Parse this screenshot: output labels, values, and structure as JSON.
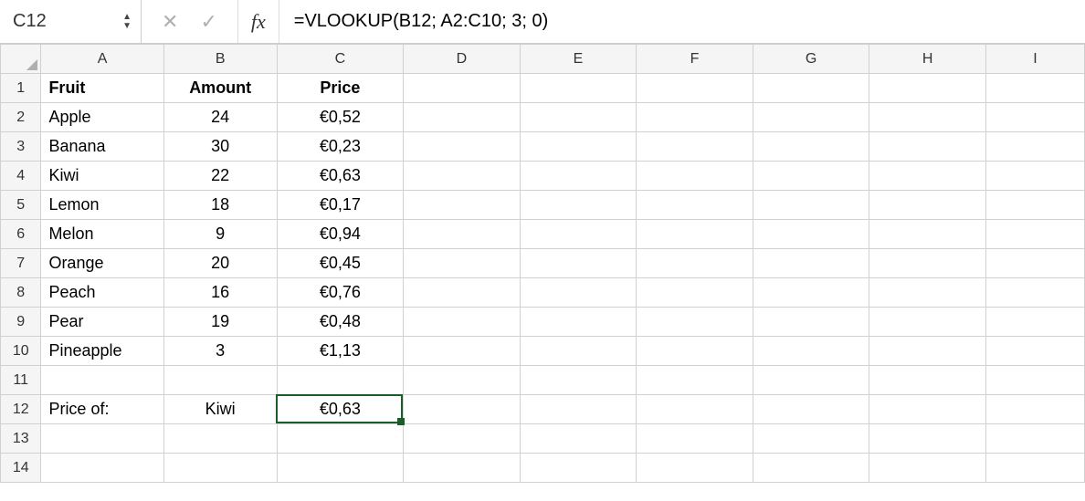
{
  "formulaBar": {
    "nameBox": "C12",
    "fxLabel": "fx",
    "formula": "=VLOOKUP(B12; A2:C10; 3; 0)"
  },
  "columns": [
    "A",
    "B",
    "C",
    "D",
    "E",
    "F",
    "G",
    "H",
    "I"
  ],
  "rowCount": 14,
  "headers": {
    "A": "Fruit",
    "B": "Amount",
    "C": "Price"
  },
  "rows": [
    {
      "fruit": "Apple",
      "amount": "24",
      "price": "€0,52"
    },
    {
      "fruit": "Banana",
      "amount": "30",
      "price": "€0,23"
    },
    {
      "fruit": "Kiwi",
      "amount": "22",
      "price": "€0,63"
    },
    {
      "fruit": "Lemon",
      "amount": "18",
      "price": "€0,17"
    },
    {
      "fruit": "Melon",
      "amount": "9",
      "price": "€0,94"
    },
    {
      "fruit": "Orange",
      "amount": "20",
      "price": "€0,45"
    },
    {
      "fruit": "Peach",
      "amount": "16",
      "price": "€0,76"
    },
    {
      "fruit": "Pear",
      "amount": "19",
      "price": "€0,48"
    },
    {
      "fruit": "Pineapple",
      "amount": "3",
      "price": "€1,13"
    }
  ],
  "lookup": {
    "label": "Price of:",
    "value": "Kiwi",
    "result": "€0,63"
  },
  "selectedCell": "C12",
  "colors": {
    "selection": "#1a5d2b"
  }
}
